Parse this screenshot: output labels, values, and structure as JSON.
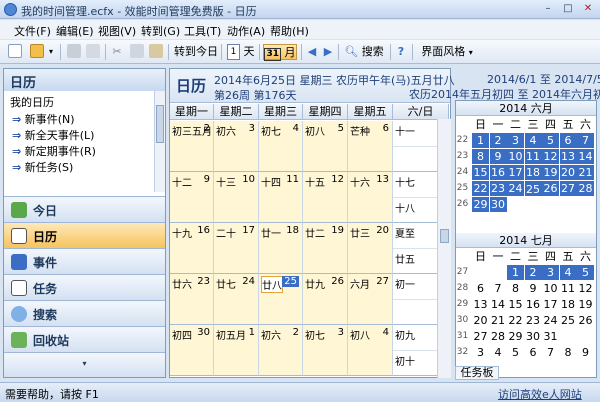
{
  "window": {
    "title": "我的时间管理.ecfx - 效能时间管理免费版 - 日历",
    "min": "–",
    "max": "□",
    "close": "✕"
  },
  "menu": [
    "文件(F)",
    "编辑(E)",
    "视图(V)",
    "转到(G)",
    "工具(T)",
    "动作(A)",
    "帮助(H)"
  ],
  "toolbar": {
    "goto_today": "转到今日",
    "day": "天",
    "day_icon": "1",
    "month": "月",
    "month_icon": "31",
    "search": "搜索",
    "style": "界面风格"
  },
  "sidebar": {
    "title": "日历",
    "tree_root": "我的日历",
    "tree_items": [
      "新事件(N)",
      "新全天事件(L)",
      "新定期事件(R)",
      "新任务(S)"
    ],
    "nav": [
      "今日",
      "日历",
      "事件",
      "任务",
      "搜索",
      "回收站"
    ],
    "active_nav": "日历"
  },
  "calendar": {
    "title": "日历",
    "date_line": "2014年6月25日 星期三 农历甲午年(马)五月廿八",
    "week_line": "第26周 第176天",
    "range": "2014/6/1 至 2014/7/5",
    "lunar_range": "农历2014年五月初四 至 2014年六月初九",
    "weekdays": [
      "星期一",
      "星期二",
      "星期三",
      "星期四",
      "星期五",
      "六/日"
    ],
    "weeks": [
      [
        {
          "l": "初三五月",
          "d": "2",
          "cur": false
        },
        {
          "l": "初六",
          "d": "3"
        },
        {
          "l": "初七",
          "d": "4"
        },
        {
          "l": "初八",
          "d": "5"
        },
        {
          "l": "芒种",
          "d": "6"
        }
      ],
      [
        {
          "l": "十二",
          "d": "9"
        },
        {
          "l": "十三",
          "d": "10"
        },
        {
          "l": "十四",
          "d": "11"
        },
        {
          "l": "十五",
          "d": "12"
        },
        {
          "l": "十六",
          "d": "13"
        }
      ],
      [
        {
          "l": "十九",
          "d": "16"
        },
        {
          "l": "二十",
          "d": "17"
        },
        {
          "l": "廿一",
          "d": "18"
        },
        {
          "l": "廿二",
          "d": "19"
        },
        {
          "l": "廿三",
          "d": "20"
        }
      ],
      [
        {
          "l": "廿六",
          "d": "23"
        },
        {
          "l": "廿七",
          "d": "24"
        },
        {
          "l": "廿八",
          "d": "25",
          "today": true
        },
        {
          "l": "廿九",
          "d": "26"
        },
        {
          "l": "六月",
          "d": "27"
        }
      ],
      [
        {
          "l": "初四",
          "d": "30"
        },
        {
          "l": "初五月",
          "d": "1"
        },
        {
          "l": "初六",
          "d": "2"
        },
        {
          "l": "初七",
          "d": "3"
        },
        {
          "l": "初八",
          "d": "4"
        }
      ]
    ],
    "weekend": [
      [
        "十一"
      ],
      [
        "十七",
        "十八"
      ],
      [
        "夏至",
        "廿五"
      ],
      [
        "初一",
        ""
      ],
      [
        "初九",
        "初十"
      ]
    ]
  },
  "minical": {
    "june_title": "2014 六月",
    "july_title": "2014 七月",
    "dow": [
      "日",
      "一",
      "二",
      "三",
      "四",
      "五",
      "六"
    ],
    "june_weeks": [
      "22",
      "23",
      "24",
      "25",
      "26",
      "27"
    ],
    "june": [
      [
        "1",
        "2",
        "3",
        "4",
        "5",
        "6",
        "7"
      ],
      [
        "8",
        "9",
        "10",
        "11",
        "12",
        "13",
        "14"
      ],
      [
        "15",
        "16",
        "17",
        "18",
        "19",
        "20",
        "21"
      ],
      [
        "22",
        "23",
        "24",
        "25",
        "26",
        "27",
        "28"
      ],
      [
        "29",
        "30",
        "",
        "",
        "",
        "",
        ""
      ]
    ],
    "july_weeks": [
      "27",
      "28",
      "29",
      "30",
      "31",
      "32"
    ],
    "july": [
      [
        "",
        "",
        "1",
        "2",
        "3",
        "4",
        "5"
      ],
      [
        "6",
        "7",
        "8",
        "9",
        "10",
        "11",
        "12"
      ],
      [
        "13",
        "14",
        "15",
        "16",
        "17",
        "18",
        "19"
      ],
      [
        "20",
        "21",
        "22",
        "23",
        "24",
        "25",
        "26"
      ],
      [
        "27",
        "28",
        "29",
        "30",
        "31",
        "",
        ""
      ],
      [
        "3",
        "4",
        "5",
        "6",
        "7",
        "8",
        "9"
      ]
    ]
  },
  "taskpanel": "任务板",
  "status": {
    "help": "需要帮助，请按 F1",
    "link": "访问高效e人网站"
  }
}
